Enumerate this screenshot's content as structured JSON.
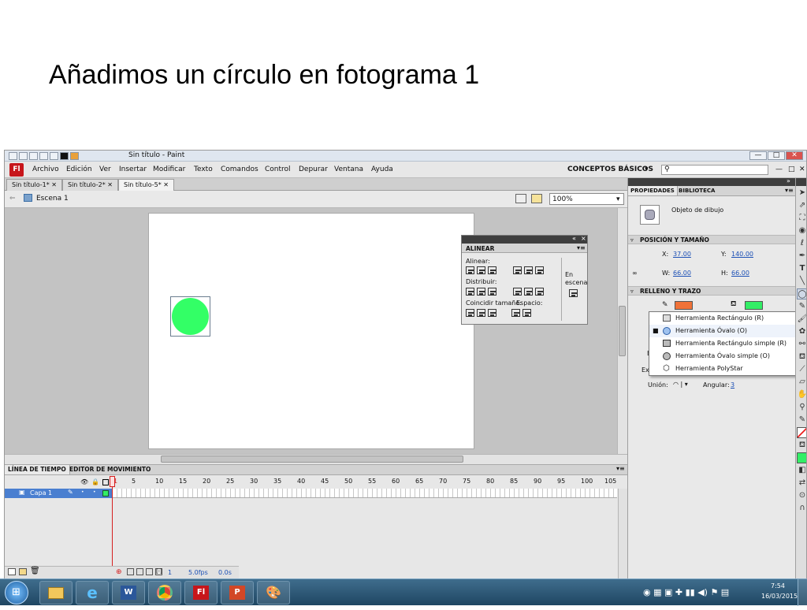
{
  "slide": {
    "title": "Añadimos un círculo en fotograma 1"
  },
  "window": {
    "title": "Sin título - Paint",
    "minimize": "—",
    "maximize": "□",
    "close": "✕"
  },
  "menu": {
    "logo": "Fl",
    "items": [
      "Archivo",
      "Edición",
      "Ver",
      "Insertar",
      "Modificar",
      "Texto",
      "Comandos",
      "Control",
      "Depurar",
      "Ventana",
      "Ayuda"
    ],
    "workspace": "CONCEPTOS BÁSICOS",
    "workspace_arrow": "▾",
    "search_placeholder": "",
    "min": "—",
    "restore": "□",
    "close": "✕"
  },
  "doc_tabs": [
    "Sin título-1*",
    "Sin título-2*",
    "Sin título-5*"
  ],
  "tab_close": "✕",
  "scene": {
    "label": "Escena 1",
    "zoom": "100%"
  },
  "colors": {
    "circle_fill": "#33ff66",
    "stroke_swatch": "#f07238",
    "fill_swatch": "#33ee66",
    "accent_red": "#c7161b"
  },
  "align_panel": {
    "title": "ALINEAR",
    "align_label": "Alinear:",
    "distribute_label": "Distribuir:",
    "match_label": "Coincidir tamaño:",
    "space_label": "Espacio:",
    "stage_label_1": "En",
    "stage_label_2": "escena"
  },
  "properties": {
    "tabs": [
      "PROPIEDADES",
      "BIBLIOTECA"
    ],
    "object_type": "Objeto de dibujo",
    "position_section": "POSICIÓN Y TAMAÑO",
    "x_label": "X:",
    "x_value": "37.00",
    "y_label": "Y:",
    "y_value": "140.00",
    "w_label": "W:",
    "w_value": "66.00",
    "h_label": "H:",
    "h_value": "66.00",
    "fill_section": "RELLENO Y TRAZO",
    "union_label": "Unión:",
    "angle_label": "Angular:",
    "angle_value": "3",
    "partial_e": "E",
    "partial_ex": "Ex"
  },
  "tool_flyout": [
    {
      "label": "Herramienta Rectángulo (R)",
      "selected": false
    },
    {
      "label": "Herramienta Óvalo (O)",
      "selected": true
    },
    {
      "label": "Herramienta Rectángulo simple (R)",
      "selected": false
    },
    {
      "label": "Herramienta Óvalo simple (O)",
      "selected": false
    },
    {
      "label": "Herramienta PolyStar",
      "selected": false
    }
  ],
  "timeline": {
    "tabs": [
      "LÍNEA DE TIEMPO",
      "EDITOR DE MOVIMIENTO"
    ],
    "layer": "Capa 1",
    "frame_numbers": [
      "5",
      "10",
      "15",
      "20",
      "25",
      "30",
      "35",
      "40",
      "45",
      "50",
      "55",
      "60",
      "65",
      "70",
      "75",
      "80",
      "85",
      "90",
      "95",
      "100",
      "105"
    ],
    "current_frame": "1",
    "fps": "5.0fps",
    "elapsed": "0.0s"
  },
  "taskbar": {
    "time": "7:54",
    "date": "16/03/2015",
    "apps": [
      "Fl"
    ]
  }
}
